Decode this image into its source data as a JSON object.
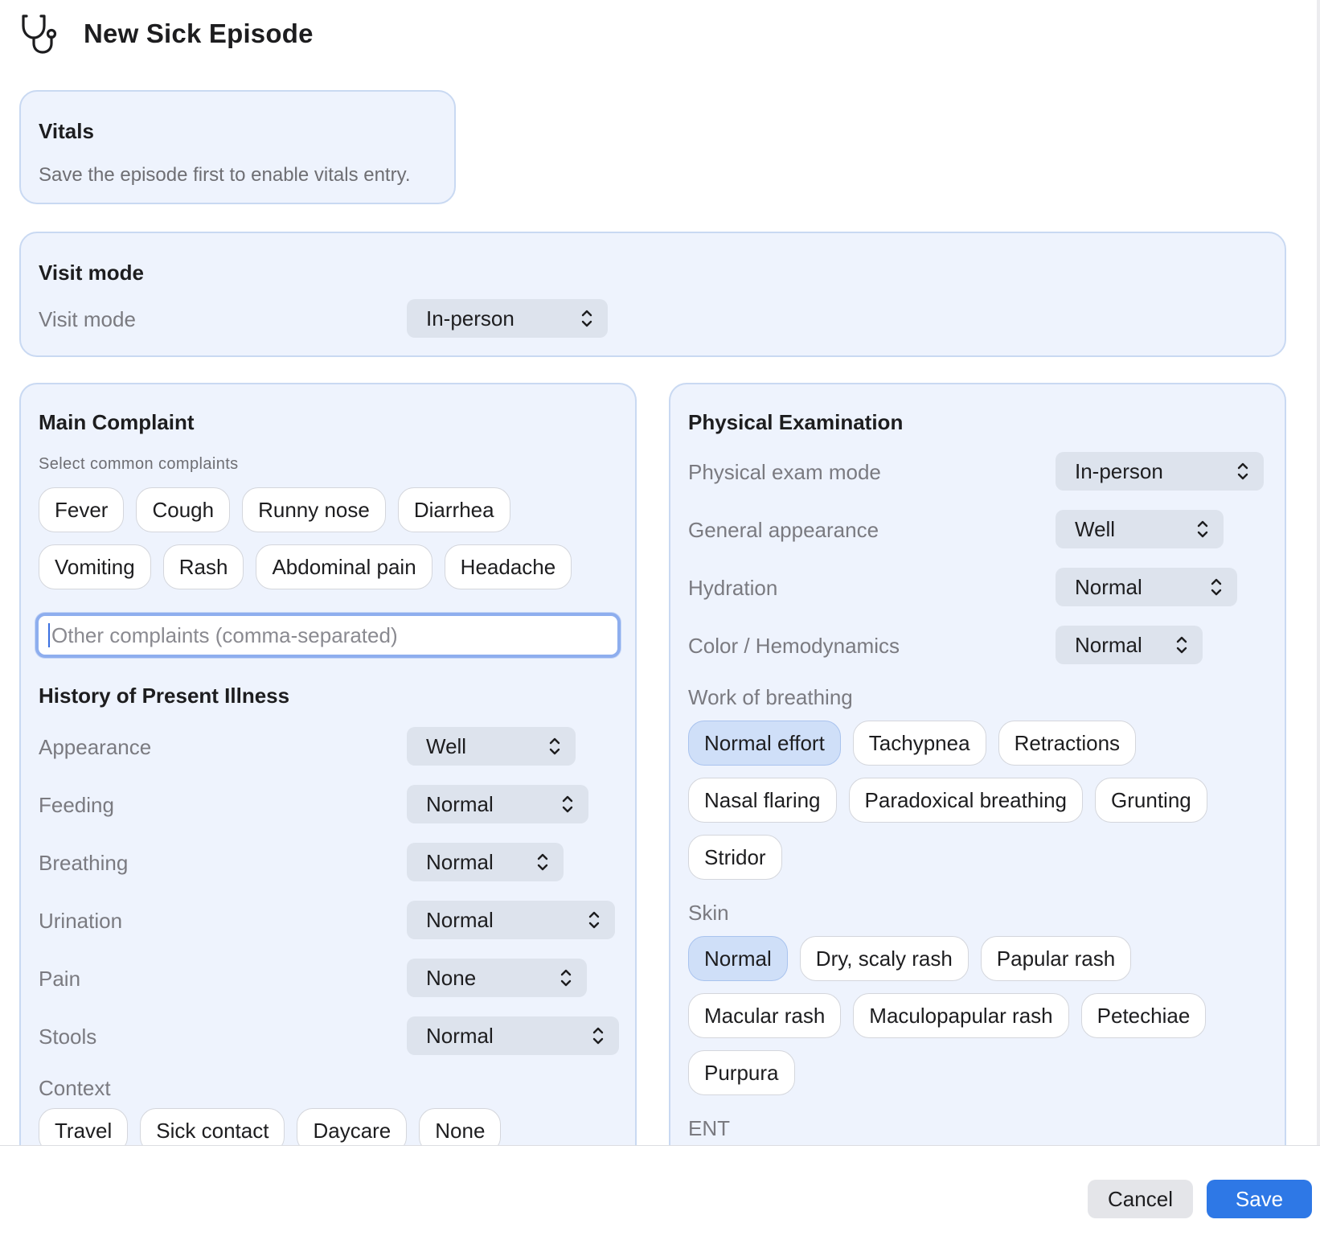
{
  "header": {
    "title": "New Sick Episode",
    "icon": "stethoscope-icon"
  },
  "vitals": {
    "title": "Vitals",
    "message": "Save the episode first to enable vitals entry."
  },
  "visit_mode": {
    "title": "Visit mode",
    "label": "Visit mode",
    "value": "In-person"
  },
  "main_complaint": {
    "title": "Main Complaint",
    "subtitle": "Select common complaints",
    "chips": [
      "Fever",
      "Cough",
      "Runny nose",
      "Diarrhea",
      "Vomiting",
      "Rash",
      "Abdominal pain",
      "Headache"
    ],
    "other_placeholder": "Other complaints (comma-separated)"
  },
  "hpi": {
    "title": "History of Present Illness",
    "fields": [
      {
        "label": "Appearance",
        "value": "Well"
      },
      {
        "label": "Feeding",
        "value": "Normal"
      },
      {
        "label": "Breathing",
        "value": "Normal"
      },
      {
        "label": "Urination",
        "value": "Normal"
      },
      {
        "label": "Pain",
        "value": "None"
      },
      {
        "label": "Stools",
        "value": "Normal"
      }
    ],
    "context_label": "Context",
    "context_chips": [
      "Travel",
      "Sick contact",
      "Daycare",
      "None"
    ]
  },
  "physical_exam": {
    "title": "Physical Examination",
    "fields": [
      {
        "label": "Physical exam mode",
        "value": "In-person"
      },
      {
        "label": "General appearance",
        "value": "Well"
      },
      {
        "label": "Hydration",
        "value": "Normal"
      },
      {
        "label": "Color / Hemodynamics",
        "value": "Normal"
      }
    ],
    "wob_label": "Work of breathing",
    "wob_chips": [
      "Normal effort",
      "Tachypnea",
      "Retractions",
      "Nasal flaring",
      "Paradoxical breathing",
      "Grunting",
      "Stridor"
    ],
    "wob_selected": "Normal effort",
    "skin_label": "Skin",
    "skin_chips": [
      "Normal",
      "Dry, scaly rash",
      "Papular rash",
      "Macular rash",
      "Maculopapular rash",
      "Petechiae",
      "Purpura"
    ],
    "skin_selected": "Normal",
    "ent_label": "ENT"
  },
  "footer": {
    "cancel": "Cancel",
    "save": "Save"
  },
  "colors": {
    "accent": "#2e78e6",
    "card_bg": "#eef3fd",
    "chip_selected": "#cfdff8"
  }
}
